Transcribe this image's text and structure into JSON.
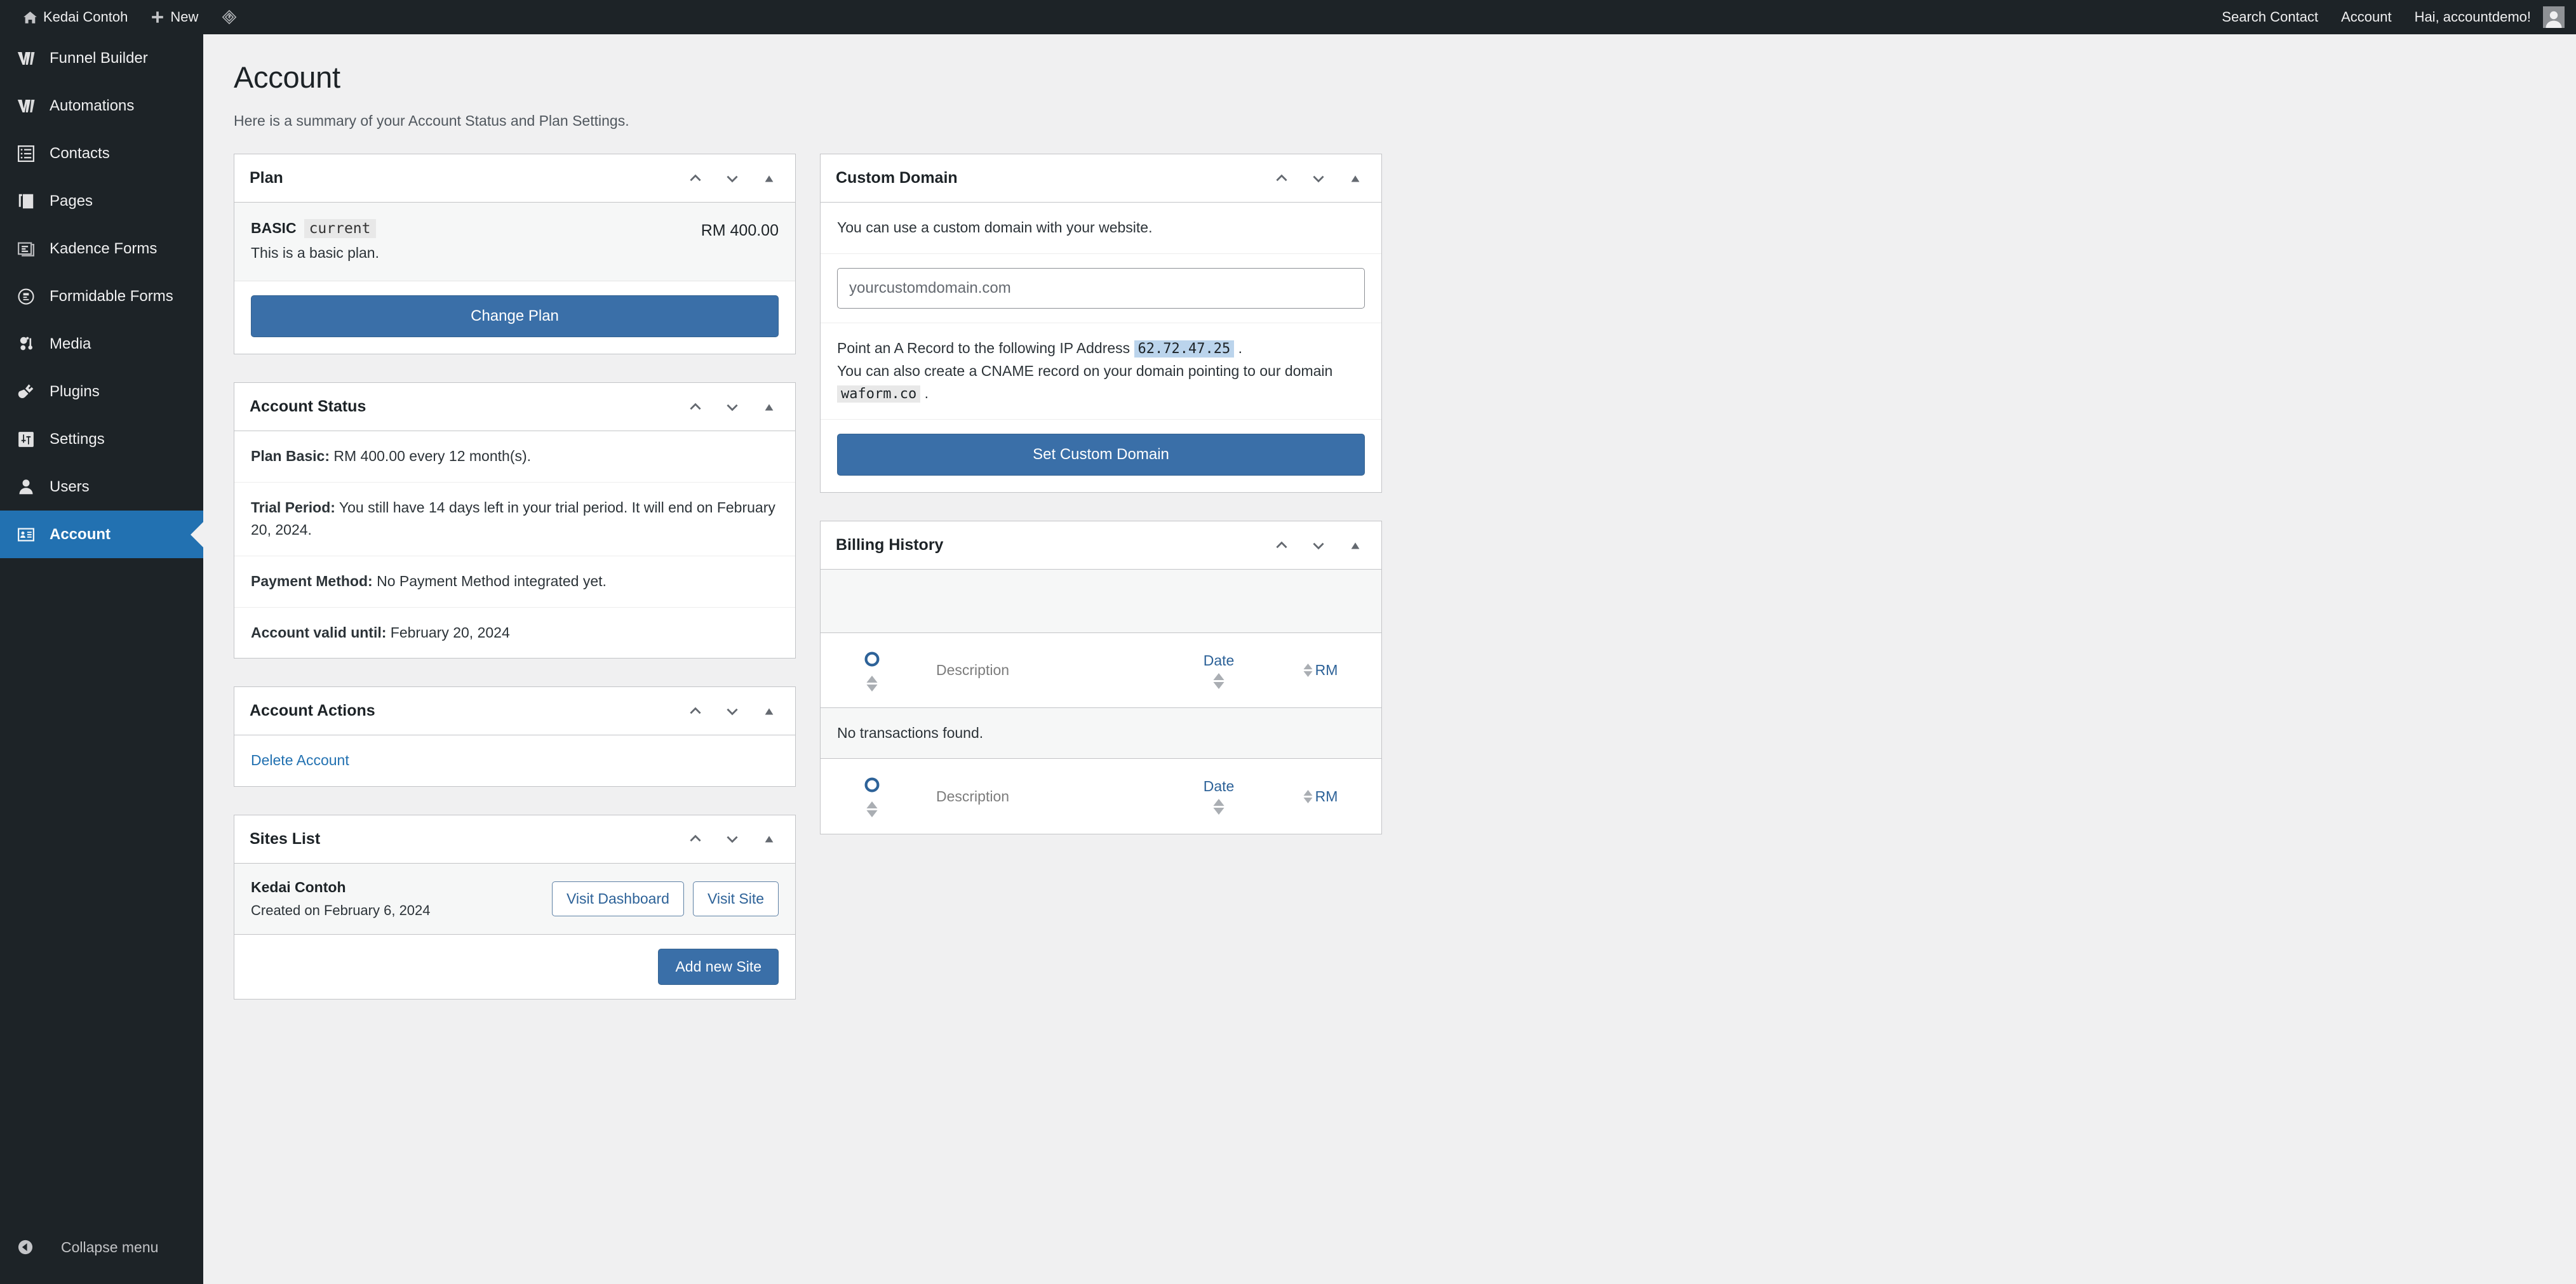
{
  "adminbar": {
    "site_name": "Kedai Contoh",
    "new_label": "New",
    "logo_icon": "wp-diamond-icon",
    "home_icon": "home-icon",
    "plus_icon": "plus-icon",
    "search_contact": "Search Contact",
    "account": "Account",
    "greeting": "Hai, accountdemo!",
    "avatar_icon": "avatar-icon"
  },
  "sidebar": {
    "items": [
      {
        "label": "Funnel Builder",
        "icon": "funnel-builder-icon",
        "active": false
      },
      {
        "label": "Automations",
        "icon": "automations-icon",
        "active": false
      },
      {
        "label": "Contacts",
        "icon": "contacts-list-icon",
        "active": false
      },
      {
        "label": "Pages",
        "icon": "pages-icon",
        "active": false
      },
      {
        "label": "Kadence Forms",
        "icon": "kadence-forms-icon",
        "active": false
      },
      {
        "label": "Formidable Forms",
        "icon": "formidable-forms-icon",
        "active": false
      },
      {
        "label": "Media",
        "icon": "media-icon",
        "active": false
      },
      {
        "label": "Plugins",
        "icon": "plugin-icon",
        "active": false
      },
      {
        "label": "Settings",
        "icon": "settings-sliders-icon",
        "active": false
      },
      {
        "label": "Users",
        "icon": "user-icon",
        "active": false
      },
      {
        "label": "Account",
        "icon": "id-card-icon",
        "active": true
      }
    ],
    "collapse_label": "Collapse menu",
    "collapse_icon": "collapse-left-icon"
  },
  "page": {
    "title": "Account",
    "subtitle": "Here is a summary of your Account Status and Plan Settings."
  },
  "panel_tools": {
    "move_up_icon": "chevron-up-icon",
    "move_down_icon": "chevron-down-icon",
    "toggle_icon": "triangle-up-icon"
  },
  "plan_panel": {
    "title": "Plan",
    "plan_name": "BASIC",
    "plan_badge": "current",
    "plan_desc": "This is a basic plan.",
    "price": "RM 400.00",
    "change_plan_label": "Change Plan"
  },
  "account_status_panel": {
    "title": "Account Status",
    "rows": [
      {
        "label": "Plan Basic:",
        "value": " RM 400.00 every 12 month(s)."
      },
      {
        "label": "Trial Period:",
        "value": " You still have 14 days left in your trial period. It will end on February 20, 2024."
      },
      {
        "label": "Payment Method:",
        "value": " No Payment Method integrated yet."
      },
      {
        "label": "Account valid until:",
        "value": " February 20, 2024"
      }
    ]
  },
  "account_actions_panel": {
    "title": "Account Actions",
    "delete_account_label": "Delete Account"
  },
  "sites_list_panel": {
    "title": "Sites List",
    "site_name": "Kedai Contoh",
    "site_created": "Created on February 6, 2024",
    "visit_dashboard_label": "Visit Dashboard",
    "visit_site_label": "Visit Site",
    "add_new_site_label": "Add new Site"
  },
  "custom_domain_panel": {
    "title": "Custom Domain",
    "intro": "You can use a custom domain with your website.",
    "input_placeholder": "yourcustomdomain.com",
    "input_value": "",
    "a_record_prefix": "Point an A Record to the following IP Address",
    "ip_address": "62.72.47.25",
    "a_record_suffix": ".",
    "cname_prefix": "You can also create a CNAME record on your domain pointing to our domain",
    "cname_domain": "waform.co",
    "cname_suffix": ".",
    "submit_label": "Set Custom Domain"
  },
  "billing_history_panel": {
    "title": "Billing History",
    "columns": {
      "id_icon": "circle-ring-icon",
      "description": "Description",
      "date": "Date",
      "amount": "RM"
    },
    "empty_message": "No transactions found.",
    "rows": []
  },
  "colors": {
    "accent_blue": "#2271B1",
    "button_blue": "#3A6FA8",
    "link_blue": "#2271B1",
    "admin_dark": "#1D2327",
    "page_bg": "#F0F0F1",
    "panel_border": "#C3C4C7",
    "ip_highlight": "#BBD4EC"
  }
}
